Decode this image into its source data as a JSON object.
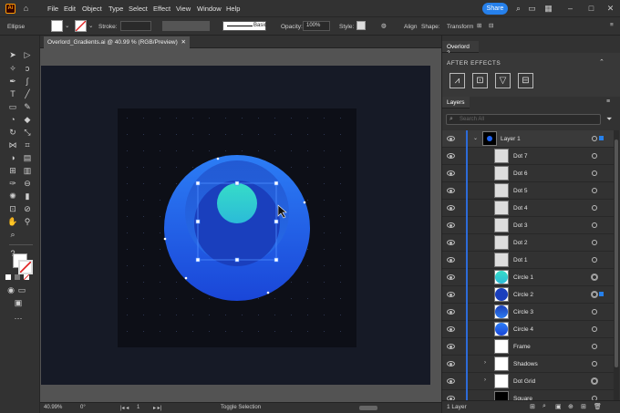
{
  "menu": {
    "logo": "Ai",
    "items": [
      "File",
      "Edit",
      "Object",
      "Type",
      "Select",
      "Effect",
      "View",
      "Window",
      "Help"
    ],
    "share": "Share"
  },
  "control": {
    "selection_name": "Ellipse",
    "stroke_label": "Stroke:",
    "profile": "Basic",
    "opacity_label": "Opacity:",
    "opacity_value": "100%",
    "style_label": "Style:",
    "align": "Align",
    "shape": "Shape:",
    "transform": "Transform"
  },
  "document": {
    "tab_title": "Overlord_Gradients.ai @ 40.99 % (RGB/Preview)"
  },
  "status": {
    "zoom": "40.99%",
    "rotation": "0°",
    "artboard_num": "1",
    "tool_hint": "Toggle Selection"
  },
  "overlord_panel": {
    "tab": "Overlord 2",
    "title": "AFTER EFFECTS"
  },
  "layers_panel": {
    "tab": "Layers",
    "search_placeholder": "Search All",
    "footer": "1 Layer",
    "layers": [
      {
        "name": "Layer 1"
      },
      {
        "name": "Dot 7"
      },
      {
        "name": "Dot 6"
      },
      {
        "name": "Dot 5"
      },
      {
        "name": "Dot 4"
      },
      {
        "name": "Dot 3"
      },
      {
        "name": "Dot 2"
      },
      {
        "name": "Dot 1"
      },
      {
        "name": "Circle 1"
      },
      {
        "name": "Circle 2"
      },
      {
        "name": "Circle 3"
      },
      {
        "name": "Circle 4"
      },
      {
        "name": "Frame"
      },
      {
        "name": "Shadows"
      },
      {
        "name": "Dot Grid"
      },
      {
        "name": "Square"
      }
    ]
  },
  "colors": {
    "accent": "#2680eb",
    "circle_blue": "#1f63f0",
    "circle_teal": "#2fd3c6"
  }
}
